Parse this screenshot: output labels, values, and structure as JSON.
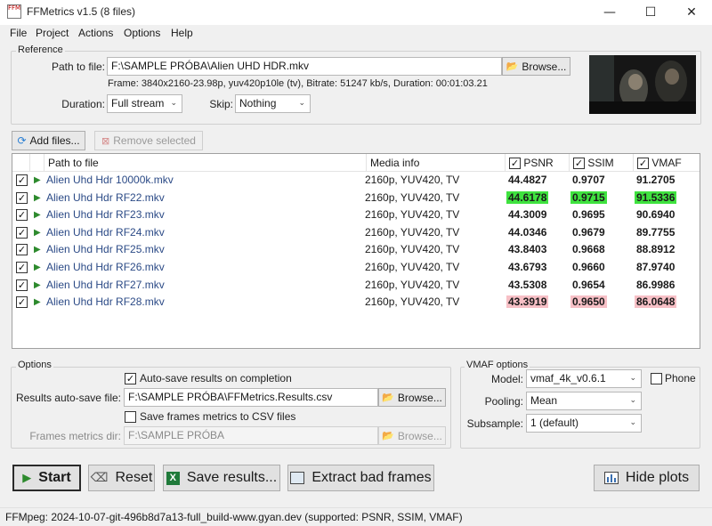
{
  "window": {
    "title": "FFMetrics v1.5 (8 files)",
    "icon_text": "FFM",
    "minimize": "—",
    "maximize": "☐",
    "close": "✕"
  },
  "menu": [
    "File",
    "Project",
    "Actions",
    "Options",
    "Help"
  ],
  "reference": {
    "group_label": "Reference",
    "path_label": "Path to file:",
    "path_value": "F:\\SAMPLE PRÓBA\\Alien UHD HDR.mkv",
    "browse_label": "Browse...",
    "frame_info": "Frame: 3840x2160-23.98p, yuv420p10le (tv), Bitrate: 51247 kb/s, Duration: 00:01:03.21",
    "duration_label": "Duration:",
    "duration_value": "Full stream",
    "skip_label": "Skip:",
    "skip_value": "Nothing"
  },
  "toolbar": {
    "add_files": "Add files...",
    "remove_selected": "Remove selected"
  },
  "list": {
    "headers": {
      "path": "Path to file",
      "media": "Media info",
      "psnr": "PSNR",
      "ssim": "SSIM",
      "vmaf": "VMAF"
    },
    "rows": [
      {
        "file": "Alien Uhd Hdr 10000k.mkv",
        "media": "2160p, YUV420, TV",
        "psnr": "44.4827",
        "ssim": "0.9707",
        "vmaf": "91.2705"
      },
      {
        "file": "Alien Uhd Hdr RF22.mkv",
        "media": "2160p, YUV420, TV",
        "psnr": "44.6178",
        "ssim": "0.9715",
        "vmaf": "91.5336"
      },
      {
        "file": "Alien Uhd Hdr RF23.mkv",
        "media": "2160p, YUV420, TV",
        "psnr": "44.3009",
        "ssim": "0.9695",
        "vmaf": "90.6940"
      },
      {
        "file": "Alien Uhd Hdr RF24.mkv",
        "media": "2160p, YUV420, TV",
        "psnr": "44.0346",
        "ssim": "0.9679",
        "vmaf": "89.7755"
      },
      {
        "file": "Alien Uhd Hdr RF25.mkv",
        "media": "2160p, YUV420, TV",
        "psnr": "43.8403",
        "ssim": "0.9668",
        "vmaf": "88.8912"
      },
      {
        "file": "Alien Uhd Hdr RF26.mkv",
        "media": "2160p, YUV420, TV",
        "psnr": "43.6793",
        "ssim": "0.9660",
        "vmaf": "87.9740"
      },
      {
        "file": "Alien Uhd Hdr RF27.mkv",
        "media": "2160p, YUV420, TV",
        "psnr": "43.5308",
        "ssim": "0.9654",
        "vmaf": "86.9986"
      },
      {
        "file": "Alien Uhd Hdr RF28.mkv",
        "media": "2160p, YUV420, TV",
        "psnr": "43.3919",
        "ssim": "0.9650",
        "vmaf": "86.0648"
      }
    ],
    "best_row": 1,
    "worst_row": 7,
    "colors": {
      "best": "#3fe23f",
      "worst": "#f7c0c6"
    }
  },
  "options": {
    "group_label": "Options",
    "autosave_label": "Auto-save results on completion",
    "results_label": "Results auto-save file:",
    "results_value": "F:\\SAMPLE PRÓBA\\FFMetrics.Results.csv",
    "browse_label": "Browse...",
    "save_frames_label": "Save frames metrics to CSV files",
    "frames_dir_label": "Frames metrics dir:",
    "frames_dir_value": "F:\\SAMPLE PRÓBA",
    "frames_browse_label": "Browse..."
  },
  "vmaf_options": {
    "group_label": "VMAF options",
    "model_label": "Model:",
    "model_value": "vmaf_4k_v0.6.1",
    "phone_label": "Phone",
    "pooling_label": "Pooling:",
    "pooling_value": "Mean",
    "subsample_label": "Subsample:",
    "subsample_value": "1 (default)"
  },
  "actions": {
    "start": "Start",
    "reset": "Reset",
    "save_results": "Save results...",
    "extract_bad_frames": "Extract bad frames",
    "hide_plots": "Hide plots"
  },
  "status": "FFMpeg: 2024-10-07-git-496b8d7a13-full_build-www.gyan.dev (supported: PSNR, SSIM, VMAF)"
}
